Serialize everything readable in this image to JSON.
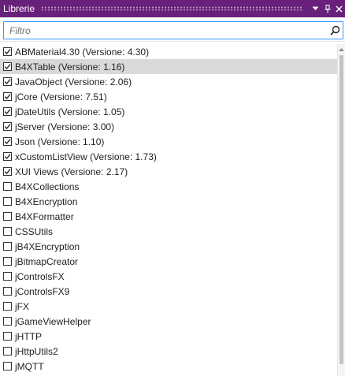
{
  "panel": {
    "title": "Librerie",
    "accent_color": "#68217a",
    "buttons": [
      "chevron-down-icon",
      "pin-icon",
      "close-icon"
    ]
  },
  "search": {
    "placeholder": "Filtro",
    "value": ""
  },
  "libraries": [
    {
      "label": "ABMaterial4.30 (Versione: 4.30)",
      "checked": true,
      "selected": false
    },
    {
      "label": "B4XTable (Versione: 1.16)",
      "checked": true,
      "selected": true
    },
    {
      "label": "JavaObject (Versione: 2.06)",
      "checked": true,
      "selected": false
    },
    {
      "label": "jCore (Versione: 7.51)",
      "checked": true,
      "selected": false
    },
    {
      "label": "jDateUtils (Versione: 1.05)",
      "checked": true,
      "selected": false
    },
    {
      "label": "jServer (Versione: 3.00)",
      "checked": true,
      "selected": false
    },
    {
      "label": "Json (Versione: 1.10)",
      "checked": true,
      "selected": false
    },
    {
      "label": "xCustomListView (Versione: 1.73)",
      "checked": true,
      "selected": false
    },
    {
      "label": "XUI Views (Versione: 2.17)",
      "checked": true,
      "selected": false
    },
    {
      "label": "B4XCollections",
      "checked": false,
      "selected": false
    },
    {
      "label": "B4XEncryption",
      "checked": false,
      "selected": false
    },
    {
      "label": "B4XFormatter",
      "checked": false,
      "selected": false
    },
    {
      "label": "CSSUtils",
      "checked": false,
      "selected": false
    },
    {
      "label": "jB4XEncryption",
      "checked": false,
      "selected": false
    },
    {
      "label": "jBitmapCreator",
      "checked": false,
      "selected": false
    },
    {
      "label": "jControlsFX",
      "checked": false,
      "selected": false
    },
    {
      "label": "jControlsFX9",
      "checked": false,
      "selected": false
    },
    {
      "label": "jFX",
      "checked": false,
      "selected": false
    },
    {
      "label": "jGameViewHelper",
      "checked": false,
      "selected": false
    },
    {
      "label": "jHTTP",
      "checked": false,
      "selected": false
    },
    {
      "label": "jHttpUtils2",
      "checked": false,
      "selected": false
    },
    {
      "label": "jMQTT",
      "checked": false,
      "selected": false
    }
  ]
}
